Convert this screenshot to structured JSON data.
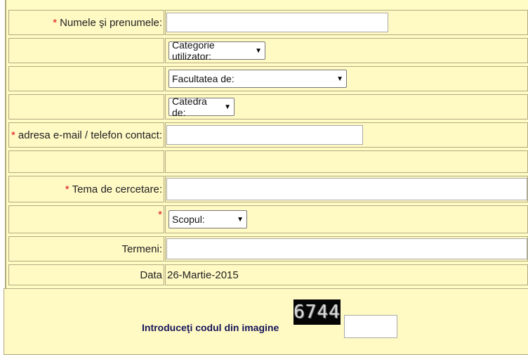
{
  "form": {
    "required_marker": "*",
    "name_label": "Numele şi prenumele:",
    "email_label": "adresa e-mail / telefon contact:",
    "topic_label": "Tema de cercetare:",
    "terms_label": "Termeni:",
    "date_label": "Data",
    "date_value": "26-Martie-2015",
    "category_select": "Categorie utilizator:",
    "faculty_select": "Facultatea de:",
    "department_select": "Catedra de:",
    "purpose_select": "Scopul:",
    "select_arrow": "▼",
    "captcha_label": "Introduceţi codul din imagine",
    "captcha_code": "6744",
    "name_value": "",
    "email_value": "",
    "topic_value": "",
    "terms_value": "",
    "captcha_value": ""
  },
  "colors": {
    "background": "#fff9c4",
    "border": "#b3aa80",
    "required": "#dd1111",
    "captcha_text": "#15155a"
  }
}
